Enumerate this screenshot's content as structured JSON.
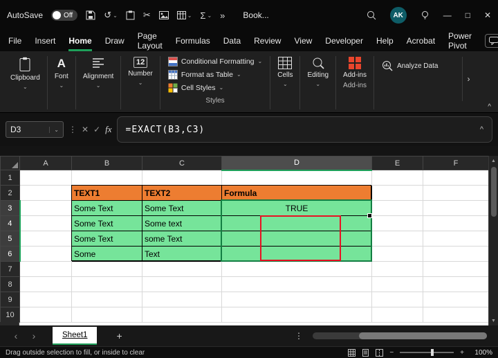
{
  "glyphs": {
    "chevron_down": "⌄",
    "chevron_up": "^",
    "more_v": "⋮",
    "more_h": "»",
    "undo": "↺",
    "scissors": "✂",
    "sigma": "Σ",
    "pencil": "✎",
    "prev": "‹",
    "next": "›",
    "plus": "+",
    "minus": "−",
    "close": "✕",
    "minimize": "—",
    "maximize": "□",
    "check": "✓",
    "cancel": "✕",
    "fx": "fx",
    "arrow_up": "▲",
    "arrow_dn": "▼",
    "font_icon": "A",
    "number_icon": "12"
  },
  "titlebar": {
    "autosave_label": "AutoSave",
    "autosave_state": "Off",
    "doc_title": "Book...",
    "avatar_initials": "AK"
  },
  "menu": {
    "tabs": [
      "File",
      "Insert",
      "Home",
      "Draw",
      "Page Layout",
      "Formulas",
      "Data",
      "Review",
      "View",
      "Developer",
      "Help",
      "Acrobat",
      "Power Pivot"
    ]
  },
  "ribbon": {
    "clipboard": "Clipboard",
    "font": "Font",
    "alignment": "Alignment",
    "number": "Number",
    "styles_buttons": [
      "Conditional Formatting",
      "Format as Table",
      "Cell Styles"
    ],
    "styles_label": "Styles",
    "cells": "Cells",
    "editing": "Editing",
    "addins_button": "Add-ins",
    "addins_label": "Add-ins",
    "analyze": "Analyze Data"
  },
  "formula_bar": {
    "name_box": "D3",
    "formula": "=EXACT(B3,C3)"
  },
  "grid": {
    "cols": [
      "A",
      "B",
      "C",
      "D",
      "E",
      "F"
    ],
    "rows": [
      "1",
      "2",
      "3",
      "4",
      "5",
      "6",
      "7",
      "8",
      "9",
      "10"
    ],
    "r2": {
      "B": "TEXT1",
      "C": "TEXT2",
      "D": "Formula"
    },
    "r3": {
      "B": "Some Text",
      "C": "Some Text",
      "D": "TRUE"
    },
    "r4": {
      "B": "Some Text",
      "C": "Some text"
    },
    "r5": {
      "B": "Some Text",
      "C": "some Text"
    },
    "r6": {
      "B": "Some",
      "C": "Text"
    }
  },
  "sheet_bar": {
    "active_tab": "Sheet1"
  },
  "status_bar": {
    "hint": "Drag outside selection to fill, or inside to clear",
    "zoom": "100%"
  },
  "colors": {
    "orange": "#ED7D31",
    "green": "#76E49A",
    "red": "#E81123",
    "accent": "#1EA05A",
    "share": "#1B7A43",
    "avatar": "#0E5C66"
  }
}
